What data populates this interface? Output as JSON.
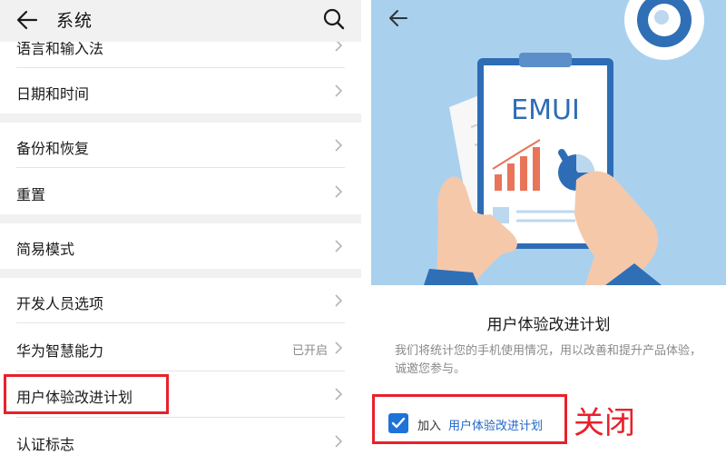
{
  "left": {
    "header": {
      "title": "系统",
      "back_icon": "back-arrow-icon",
      "search_icon": "search-icon"
    },
    "items": [
      {
        "label": "语言和输入法",
        "value": ""
      },
      {
        "label": "日期和时间",
        "value": ""
      },
      {
        "label": "备份和恢复",
        "value": ""
      },
      {
        "label": "重置",
        "value": ""
      },
      {
        "label": "简易模式",
        "value": ""
      },
      {
        "label": "开发人员选项",
        "value": ""
      },
      {
        "label": "华为智慧能力",
        "value": "已开启"
      },
      {
        "label": "用户体验改进计划",
        "value": ""
      },
      {
        "label": "认证标志",
        "value": ""
      }
    ]
  },
  "right": {
    "hero": {
      "brand_text": "EMUI",
      "back_icon": "back-arrow-icon"
    },
    "title": "用户体验改进计划",
    "description": "我们将统计您的手机使用情况，用以改善和提升产品体验，诚邀您参与。",
    "join_prefix": "加入",
    "join_link": "用户体验改进计划",
    "checkbox_checked": true
  },
  "annotation": {
    "text": "关闭"
  },
  "colors": {
    "highlight": "#e8212b",
    "accent": "#1e73d8",
    "hero_bg": "#a9d1ee",
    "section_bg": "#f1f1f1"
  }
}
